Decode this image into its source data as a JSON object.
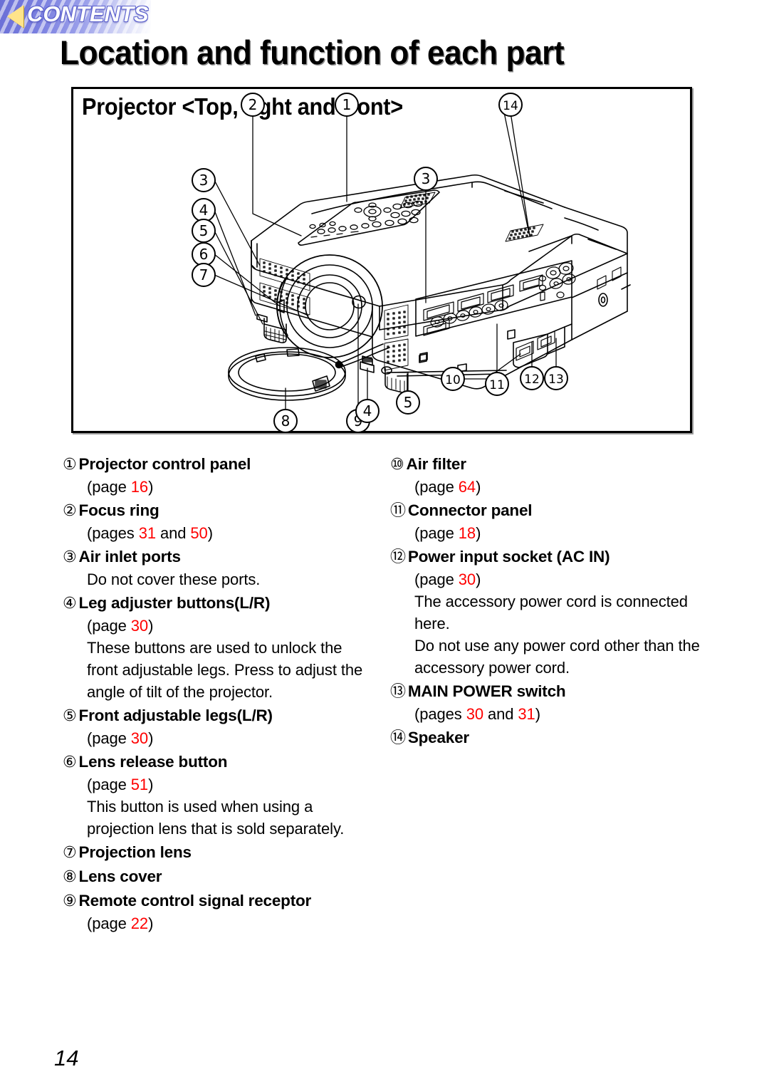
{
  "badge": {
    "label": "CONTENTS",
    "triangle_icon": "back-triangle-icon",
    "accent_color": "#7b80e0",
    "triangle_color": "#ffe48a"
  },
  "page_title": "Location and function of each part",
  "figure": {
    "title": "Projector <Top, right and front>",
    "callouts": [
      "1",
      "2",
      "3",
      "3",
      "4",
      "4",
      "5",
      "5",
      "6",
      "7",
      "8",
      "9",
      "10",
      "11",
      "12",
      "13",
      "14"
    ]
  },
  "parts_left": [
    {
      "num": "①",
      "title": "Projector control panel",
      "lines": [
        {
          "text_before": "(page ",
          "page": "16",
          "text_after": ")"
        }
      ]
    },
    {
      "num": "②",
      "title": "Focus ring",
      "lines": [
        {
          "text_before": "(pages ",
          "page": "31",
          "text_mid": " and ",
          "page2": "50",
          "text_after": ")"
        }
      ]
    },
    {
      "num": "③",
      "title": "Air inlet ports",
      "lines": [
        {
          "text_before": "Do not cover these ports."
        }
      ]
    },
    {
      "num": "④",
      "title": "Leg adjuster buttons(L/R)",
      "lines": [
        {
          "text_before": "(page ",
          "page": "30",
          "text_after": ")"
        },
        {
          "text_before": "These buttons are used to unlock the front adjustable legs. Press to adjust the angle of tilt of the projector."
        }
      ]
    },
    {
      "num": "⑤",
      "title": "Front adjustable legs(L/R)",
      "lines": [
        {
          "text_before": "(page ",
          "page": "30",
          "text_after": ")"
        }
      ]
    },
    {
      "num": "⑥",
      "title": "Lens release button",
      "lines": [
        {
          "text_before": "(page ",
          "page": "51",
          "text_after": ")"
        },
        {
          "text_before": "This button is used when using a projection lens that is sold separately."
        }
      ]
    },
    {
      "num": "⑦",
      "title": "Projection lens",
      "lines": []
    },
    {
      "num": "⑧",
      "title": "Lens cover",
      "lines": []
    },
    {
      "num": "⑨",
      "title": "Remote control signal receptor",
      "lines": [
        {
          "text_before": "(page ",
          "page": "22",
          "text_after": ")"
        }
      ]
    }
  ],
  "parts_right": [
    {
      "num": "⑩",
      "title": "Air filter",
      "lines": [
        {
          "text_before": "(page ",
          "page": "64",
          "text_after": ")"
        }
      ]
    },
    {
      "num": "⑪",
      "title": "Connector panel",
      "lines": [
        {
          "text_before": "(page ",
          "page": "18",
          "text_after": ")"
        }
      ]
    },
    {
      "num": "⑫",
      "title": "Power input socket (AC IN)",
      "lines": [
        {
          "text_before": "(page ",
          "page": "30",
          "text_after": ")"
        },
        {
          "text_before": "The accessory power cord is connected here."
        },
        {
          "text_before": "Do not use any power cord other than the accessory power cord."
        }
      ]
    },
    {
      "num": "⑬",
      "title": "MAIN POWER switch",
      "lines": [
        {
          "text_before": "(pages ",
          "page": "30",
          "text_mid": " and ",
          "page2": "31",
          "text_after": ")"
        }
      ]
    },
    {
      "num": "⑭",
      "title": "Speaker",
      "lines": []
    }
  ],
  "folio": "14"
}
